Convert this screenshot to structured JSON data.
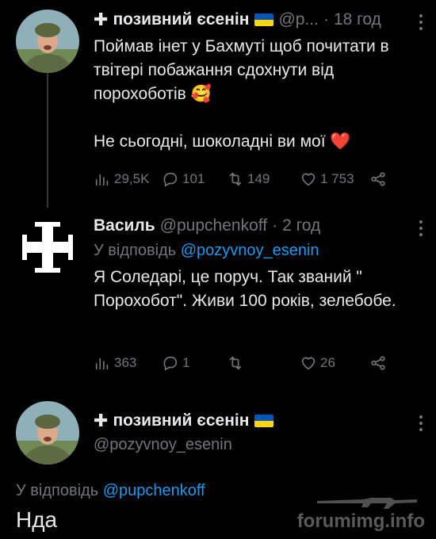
{
  "tweet1": {
    "name": "позивний єсенін",
    "handle": "@p...",
    "time": "18 год",
    "text": "Поймав інет у Бахмуті щоб почитати в твітері побажання сдохнути від порохоботів 🥰\n\nНе сьогодні, шоколадні ви мої ❤️",
    "views": "29,5K",
    "replies": "101",
    "retweets": "149",
    "likes": "1 753"
  },
  "tweet2": {
    "name": "Василь",
    "handle": "@pupchenkoff",
    "time": "2 год",
    "reply_prefix": "У відповідь",
    "reply_to": "@pozyvnoy_esenin",
    "text": "Я Соледарі, це поруч. Так званий \" Порохобот\". Живи 100 років, зелебобе.",
    "views": "363",
    "replies": "1",
    "retweets": "",
    "likes": "26"
  },
  "tweet3": {
    "name": "позивний єсенін",
    "handle": "@pozyvnoy_esenin",
    "reply_prefix": "У відповідь",
    "reply_to": "@pupchenkoff",
    "text": "Нда"
  },
  "watermark": "forumimg.info",
  "colors": {
    "background": "#000000",
    "text": "#e7e9ea",
    "muted": "#71767b",
    "link": "#1d9bf0",
    "flag_blue": "#0057b7",
    "flag_yellow": "#ffd700"
  },
  "icons": [
    "views-icon",
    "reply-icon",
    "retweet-icon",
    "like-icon",
    "share-icon",
    "more-icon"
  ]
}
